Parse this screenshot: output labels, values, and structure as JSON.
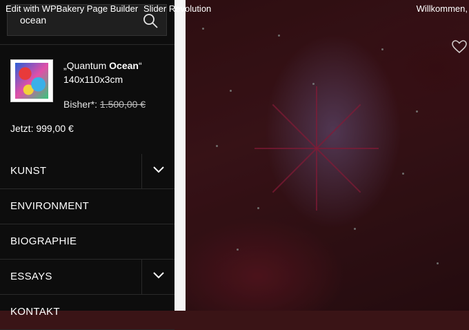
{
  "adminbar": {
    "edit_link": "Edit with WPBakery Page Builder",
    "slider_link": "Slider Revolution",
    "greeting": "Willkommen,"
  },
  "search": {
    "value": "ocean"
  },
  "product": {
    "title_prefix": "„Quantum ",
    "title_highlight": "Ocean",
    "title_suffix": "“",
    "size": "140x110x3cm",
    "old_price_label": "Bisher*: ",
    "old_price": "1.500,00 €",
    "current_price": "Jetzt: 999,00 €"
  },
  "menu": {
    "items": [
      {
        "label": "KUNST"
      },
      {
        "label": "ENVIRONMENT"
      },
      {
        "label": "BIOGRAPHIE"
      },
      {
        "label": "ESSAYS"
      },
      {
        "label": "KONTAKT"
      }
    ]
  },
  "colors": {
    "sidebar_bg": "#0d0d0d",
    "text": "#ffffff",
    "divider": "#2a2a2a"
  }
}
